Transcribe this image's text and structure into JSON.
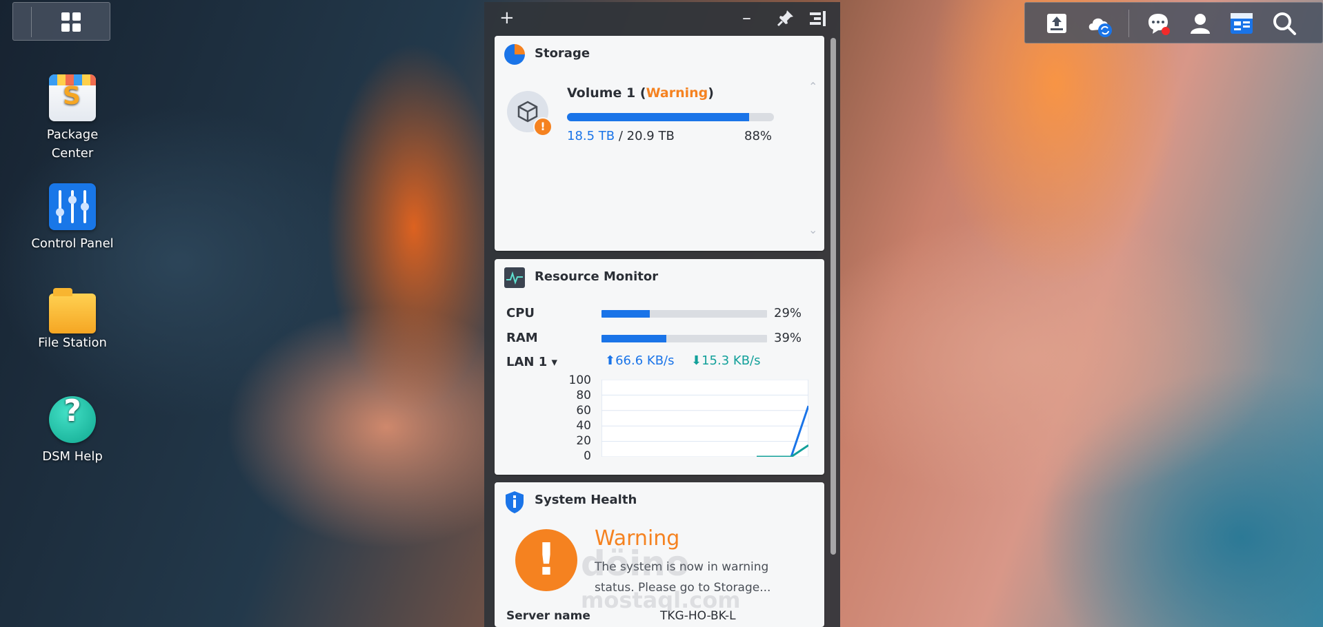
{
  "desktop": {
    "icons": [
      {
        "label_line1": "Package",
        "label_line2": "Center",
        "icon": "package-center-icon"
      },
      {
        "label": "Control Panel",
        "icon": "control-panel-icon"
      },
      {
        "label": "File Station",
        "icon": "file-station-icon"
      },
      {
        "label": "DSM Help",
        "icon": "dsm-help-icon"
      }
    ]
  },
  "widgets_toolbar": {
    "add": "+",
    "minimize": "–",
    "pin_icon": "pin-icon",
    "collapse_icon": "collapse-panel-icon"
  },
  "storage": {
    "title": "Storage",
    "volume_name": "Volume 1",
    "status": "Warning",
    "used": "18.5 TB",
    "separator": " / ",
    "total": "20.9 TB",
    "percent_text": "88%",
    "usage_fraction": 0.88,
    "chevron_up": "⌃",
    "chevron_down": "⌄"
  },
  "resource_monitor": {
    "title": "Resource Monitor",
    "cpu_label": "CPU",
    "cpu_text": "29%",
    "cpu_fraction": 0.29,
    "ram_label": "RAM",
    "ram_text": "39%",
    "ram_fraction": 0.39,
    "lan_label": "LAN 1",
    "upload": "66.6 KB/s",
    "download": "15.3 KB/s",
    "chart_data": {
      "type": "line",
      "ylim": [
        0,
        100
      ],
      "yticks": [
        "100",
        "80",
        "60",
        "40",
        "20",
        "0"
      ],
      "series": [
        {
          "color": "#1a74e8",
          "x": [
            0,
            1,
            2,
            3,
            4,
            5,
            6,
            7,
            8,
            9,
            10,
            11,
            12
          ],
          "values": [
            null,
            null,
            null,
            null,
            null,
            null,
            null,
            null,
            null,
            0,
            0,
            0,
            66
          ]
        },
        {
          "color": "#12a09a",
          "x": [
            0,
            1,
            2,
            3,
            4,
            5,
            6,
            7,
            8,
            9,
            10,
            11,
            12
          ],
          "values": [
            null,
            null,
            null,
            null,
            null,
            null,
            null,
            null,
            null,
            0,
            0,
            0,
            15
          ]
        }
      ]
    }
  },
  "system_health": {
    "title": "System Health",
    "status": "Warning",
    "message": "The system is now in warning status. Please go to Storage...",
    "server_name_label": "Server name",
    "server_name_value": "TKG-HO-BK-L"
  },
  "watermark": {
    "line1": "döino",
    "line2": "mostaql.com"
  },
  "tray": {
    "icons": [
      "upload-icon",
      "cloud-sync-icon",
      "notifications-icon",
      "user-icon",
      "widgets-icon",
      "search-icon"
    ],
    "notification_badge_color": "#f22a2a"
  }
}
